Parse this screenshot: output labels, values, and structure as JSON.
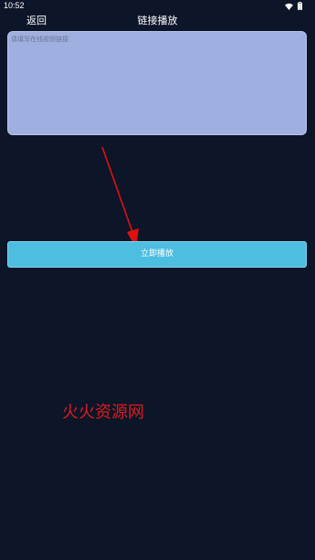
{
  "status_bar": {
    "time": "10:52",
    "icons": [
      "wifi-icon",
      "battery-icon"
    ]
  },
  "header": {
    "back_label": "返回",
    "title": "链接播放"
  },
  "link_input": {
    "placeholder": "请填写在线视频链接",
    "value": ""
  },
  "play_button": {
    "label": "立即播放"
  },
  "annotation": {
    "arrow_color": "#e01010",
    "icon": "arrow-icon"
  },
  "watermark": {
    "text": "火火资源网",
    "color": "#d81e1e"
  },
  "colors": {
    "background": "#0d1528",
    "input_background": "#9fb0e0",
    "button_background": "#4dbde0"
  }
}
